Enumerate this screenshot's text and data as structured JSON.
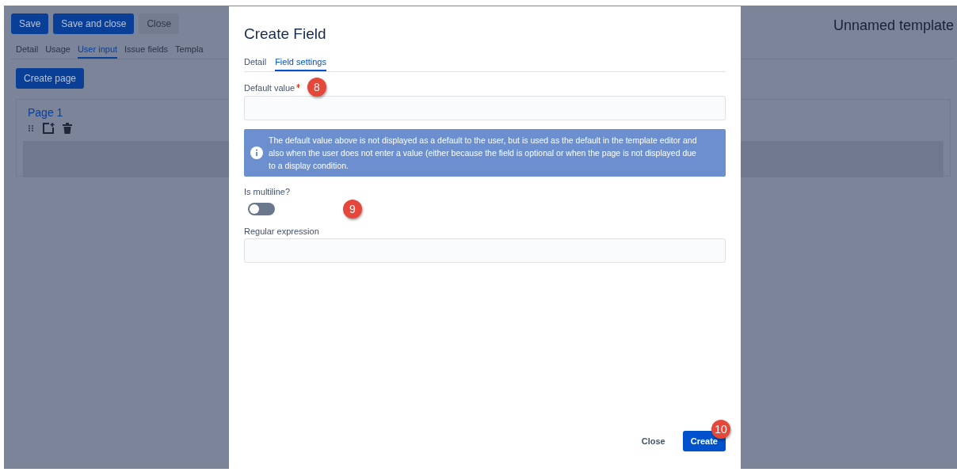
{
  "toolbar": {
    "buttons": [
      {
        "label": "Save",
        "kind": "primary"
      },
      {
        "label": "Save and close",
        "kind": "primary"
      },
      {
        "label": "Close",
        "kind": "subtle"
      }
    ],
    "title": "Unnamed template"
  },
  "tabs": [
    {
      "label": "Detail",
      "selected": false
    },
    {
      "label": "Usage",
      "selected": false
    },
    {
      "label": "User input",
      "selected": true
    },
    {
      "label": "Issue fields",
      "selected": false
    },
    {
      "label": "Templa",
      "selected": false
    }
  ],
  "create_page_button": "Create page",
  "page_card": {
    "title": "Page 1"
  },
  "dialog": {
    "title": "Create Field",
    "tabs": [
      {
        "label": "Detail",
        "selected": false
      },
      {
        "label": "Field settings",
        "selected": true
      }
    ],
    "default_value": {
      "label": "Default value",
      "required": true,
      "marker": "8"
    },
    "info": "The default value above is not displayed as a default to the user, but is used as the default in the template editor and also when the user does not enter a value (either because the field is optional or when the page is not displayed due to a display condition.",
    "multiline": {
      "label": "Is multiline?",
      "checked": false,
      "marker": "9"
    },
    "regex": {
      "label": "Regular expression"
    },
    "buttons": [
      {
        "label": "Close",
        "kind": "subtle"
      },
      {
        "label": "Create",
        "kind": "primary",
        "marker": "10"
      }
    ]
  }
}
